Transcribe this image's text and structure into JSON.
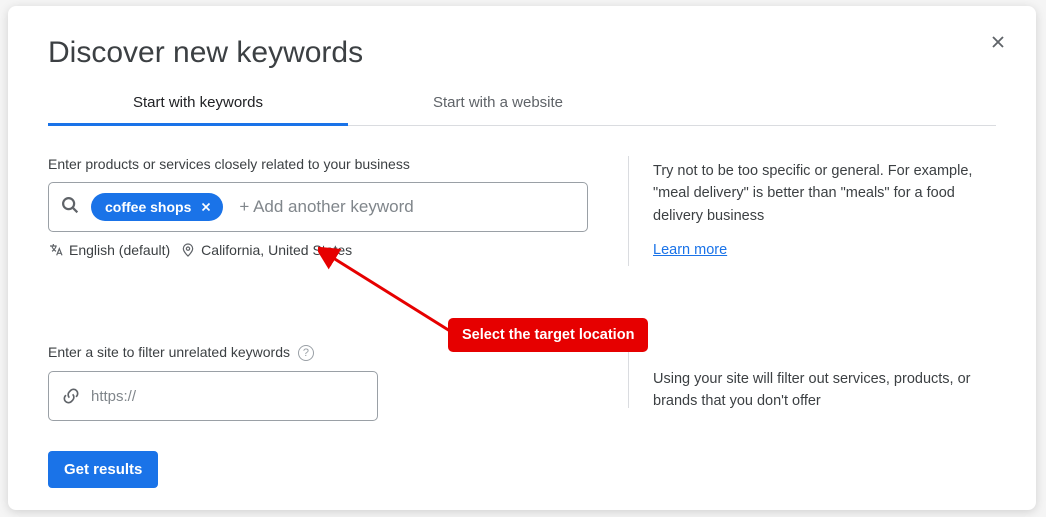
{
  "title": "Discover new keywords",
  "tabs": {
    "keywords": "Start with keywords",
    "website": "Start with a website"
  },
  "keyword_section": {
    "label": "Enter products or services closely related to your business",
    "chip": "coffee shops",
    "placeholder": "+ Add another keyword",
    "language": "English (default)",
    "location": "California, United States",
    "tip": "Try not to be too specific or general. For example, \"meal delivery\" is better than \"meals\" for a food delivery business",
    "learn_more": "Learn more"
  },
  "filter_section": {
    "label": "Enter a site to filter unrelated keywords",
    "placeholder": "https://",
    "tip": "Using your site will filter out services, products, or brands that you don't offer"
  },
  "buttons": {
    "get_results": "Get results"
  },
  "annotation": {
    "label": "Select the target location"
  }
}
